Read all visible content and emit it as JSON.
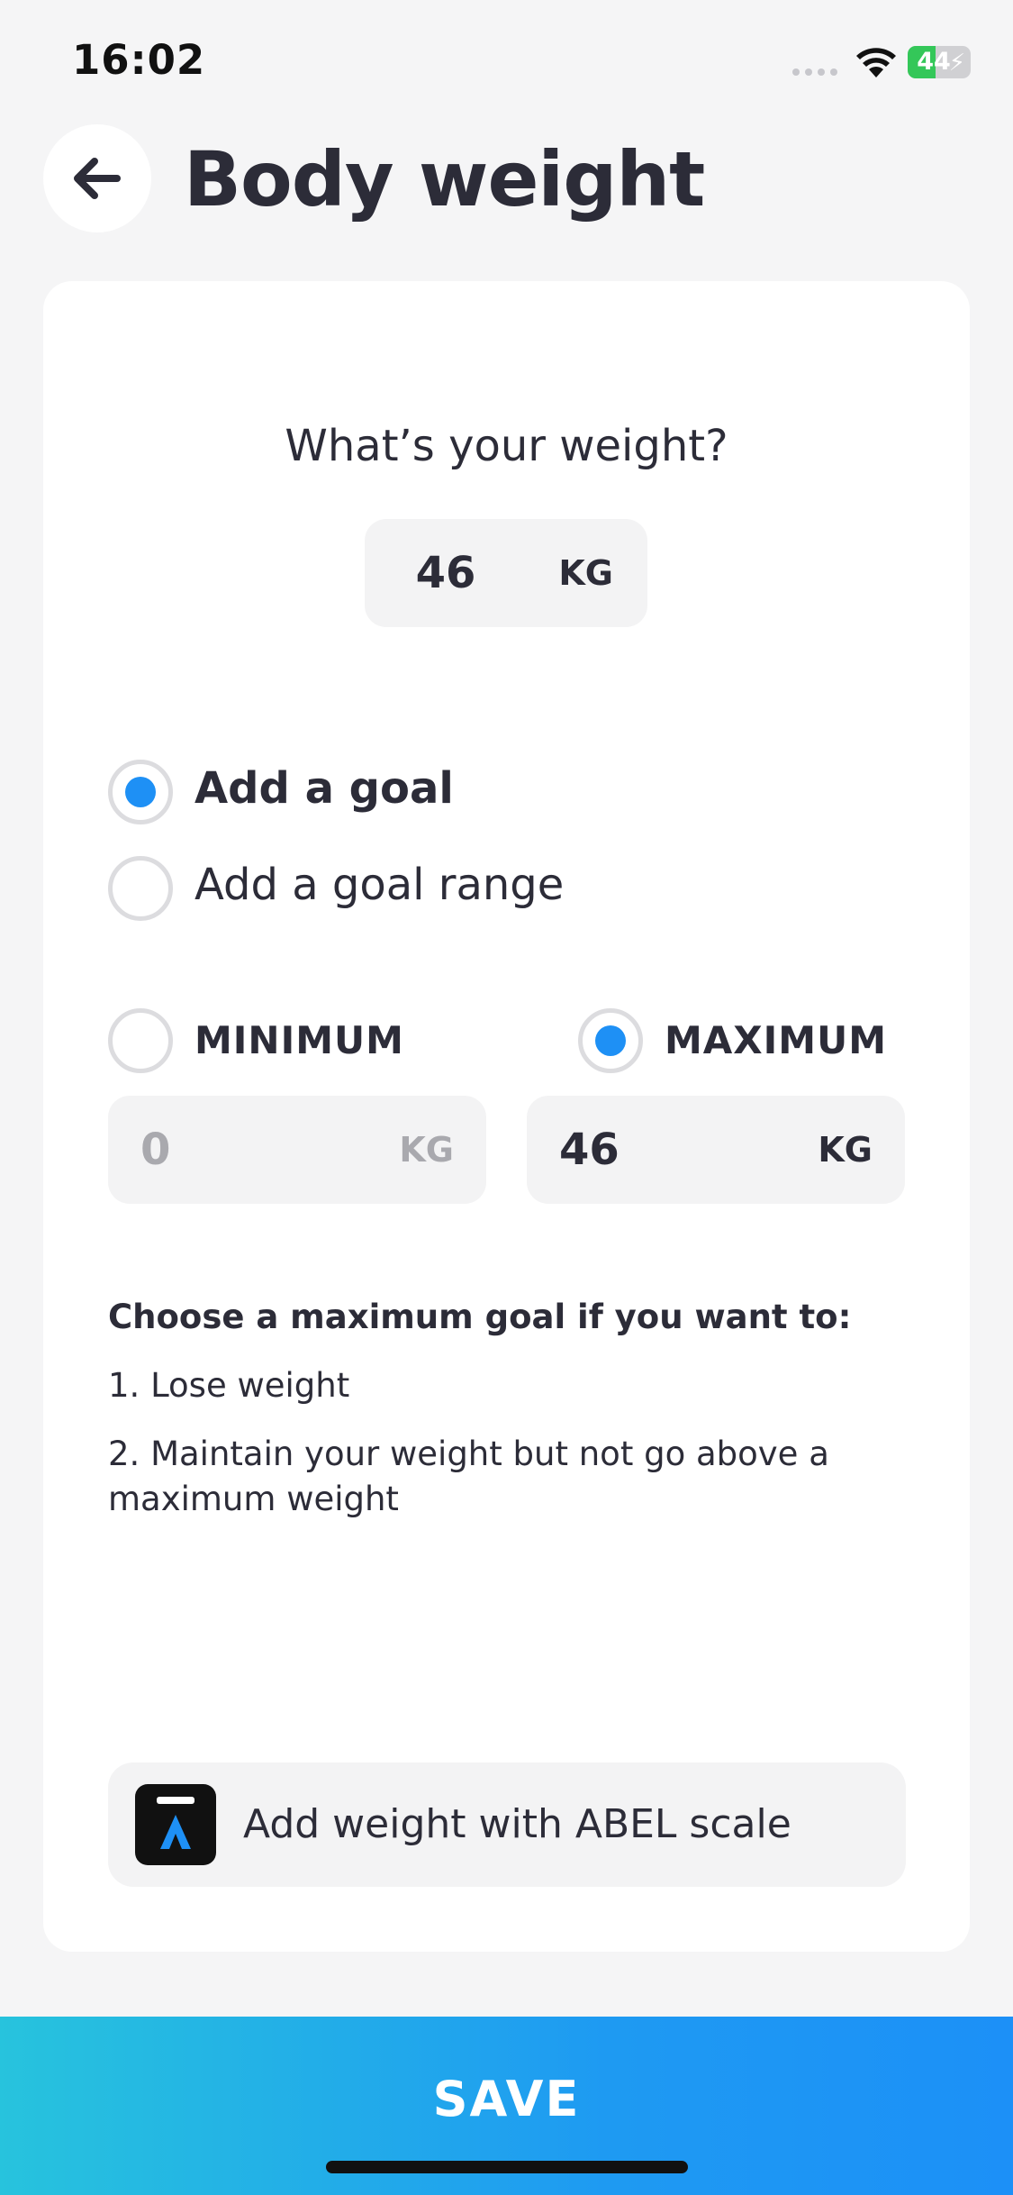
{
  "status_bar": {
    "time": "16:02",
    "battery_level": "44",
    "battery_fraction": 0.44
  },
  "header": {
    "title": "Body weight",
    "back_icon": "arrow-left-icon"
  },
  "weight": {
    "question": "What’s your weight?",
    "value": "46",
    "unit": "KG"
  },
  "goal_type": {
    "options": [
      {
        "label": "Add a goal",
        "selected": true
      },
      {
        "label": "Add a goal range",
        "selected": false
      }
    ]
  },
  "goal_bounds": {
    "minimum": {
      "label": "MINIMUM",
      "value": "0",
      "unit": "KG",
      "selected": false
    },
    "maximum": {
      "label": "MAXIMUM",
      "value": "46",
      "unit": "KG",
      "selected": true
    }
  },
  "info": {
    "title": "Choose a maximum goal if you want to:",
    "lines": [
      "1. Lose weight",
      "2. Maintain your weight but not go above a maximum weight"
    ]
  },
  "abel": {
    "label": "Add weight with ABEL scale",
    "icon": "abel-logo-icon"
  },
  "save": {
    "label": "SAVE"
  },
  "colors": {
    "accent": "#1e90f5",
    "gradient_start": "#27c3dd",
    "gradient_end": "#1c90f7",
    "battery": "#34c759"
  }
}
